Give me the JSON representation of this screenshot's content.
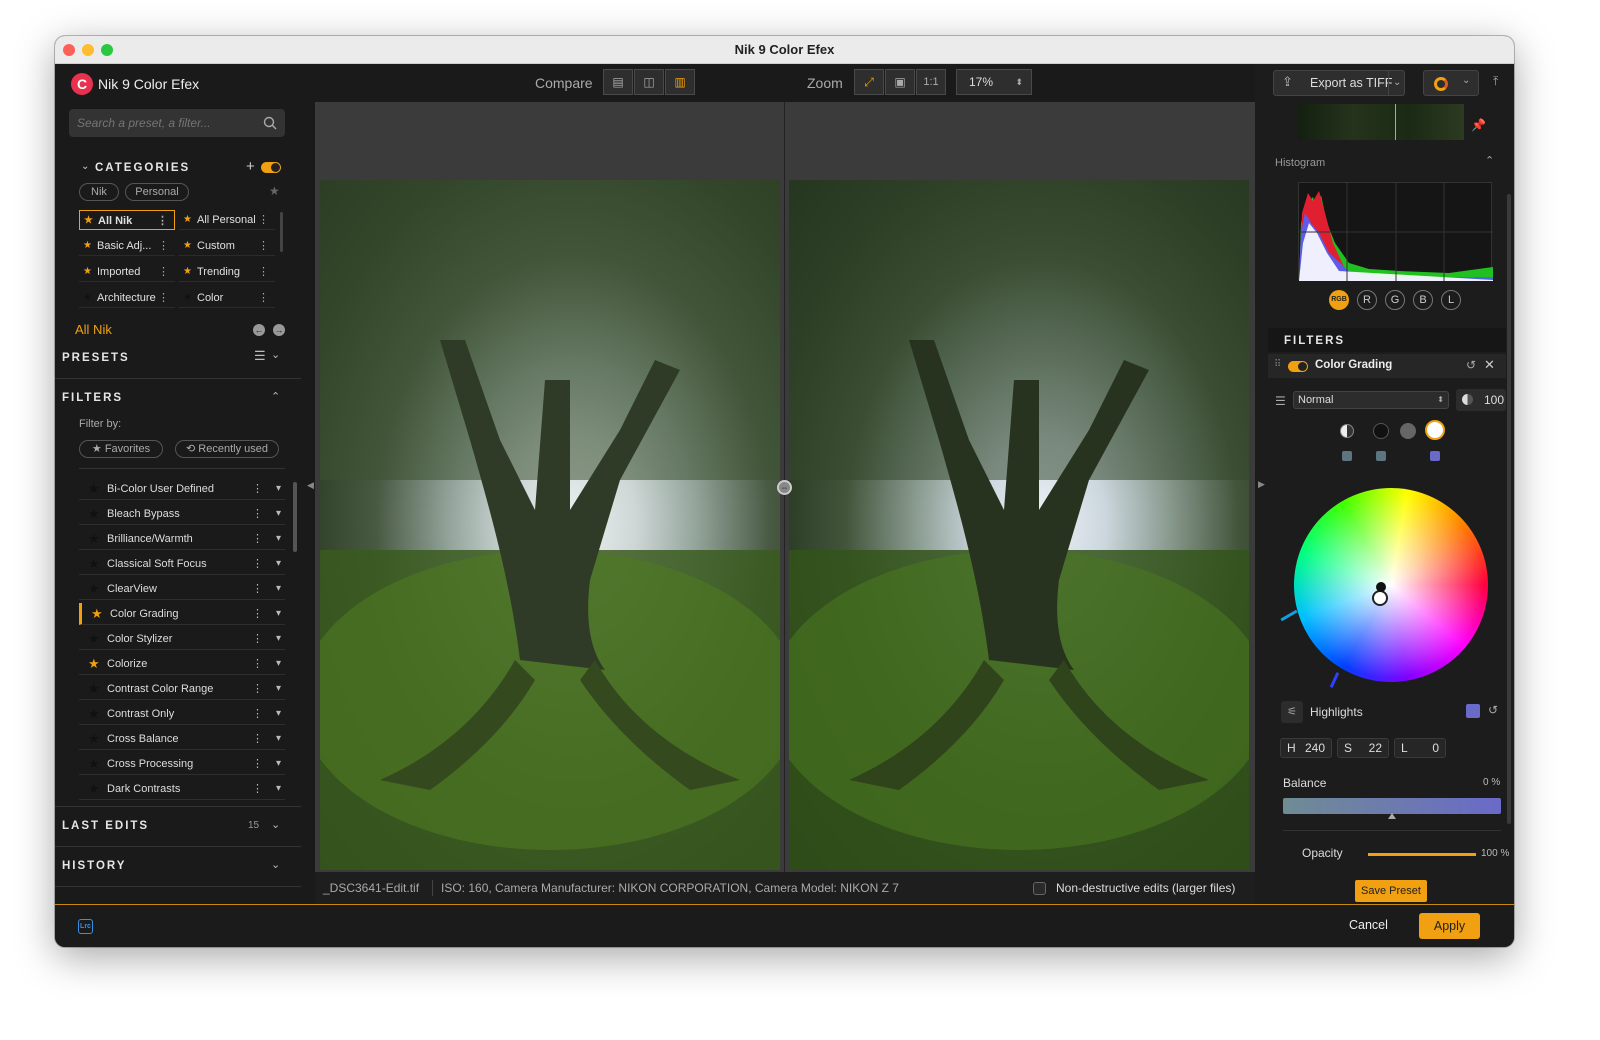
{
  "window": {
    "title": "Nik 9 Color Efex"
  },
  "app": {
    "name": "Nik 9 Color Efex"
  },
  "search": {
    "placeholder": "Search a preset, a filter..."
  },
  "categories": {
    "heading": "CATEGORIES",
    "tabs": [
      "Nik",
      "Personal"
    ],
    "items": [
      {
        "label": "All Nik",
        "starred": true,
        "active": true
      },
      {
        "label": "All Personal",
        "starred": true
      },
      {
        "label": "Basic Adj...",
        "starred": true
      },
      {
        "label": "Custom",
        "starred": true
      },
      {
        "label": "Imported",
        "starred": true
      },
      {
        "label": "Trending",
        "starred": true
      },
      {
        "label": "Architecture",
        "starred": false
      },
      {
        "label": "Color",
        "starred": false
      }
    ],
    "current": "All Nik"
  },
  "presets": {
    "heading": "PRESETS"
  },
  "filters_panel": {
    "heading": "FILTERS",
    "filter_by": "Filter by:",
    "favorites": "★ Favorites",
    "recently_used": "⟲ Recently used",
    "items": [
      {
        "label": "Bi-Color User Defined",
        "fav": false
      },
      {
        "label": "Bleach Bypass",
        "fav": false
      },
      {
        "label": "Brilliance/Warmth",
        "fav": false
      },
      {
        "label": "Classical Soft Focus",
        "fav": false
      },
      {
        "label": "ClearView",
        "fav": false
      },
      {
        "label": "Color Grading",
        "fav": true,
        "selected": true
      },
      {
        "label": "Color Stylizer",
        "fav": false
      },
      {
        "label": "Colorize",
        "fav": true
      },
      {
        "label": "Contrast Color Range",
        "fav": false
      },
      {
        "label": "Contrast Only",
        "fav": false
      },
      {
        "label": "Cross Balance",
        "fav": false
      },
      {
        "label": "Cross Processing",
        "fav": false
      },
      {
        "label": "Dark Contrasts",
        "fav": false
      }
    ]
  },
  "last_edits": {
    "heading": "LAST EDITS",
    "count": "15"
  },
  "history": {
    "heading": "HISTORY"
  },
  "toolbar": {
    "compare_label": "Compare",
    "zoom_label": "Zoom",
    "one_to_one": "1:1",
    "zoom_value": "17%"
  },
  "status": {
    "filename": "_DSC3641-Edit.tif",
    "meta": "ISO: 160, Camera Manufacturer: NIKON CORPORATION, Camera Model: NIKON Z 7",
    "nondestructive": "Non-destructive edits (larger files)"
  },
  "export": {
    "label": "Export as TIFF"
  },
  "histogram": {
    "label": "Histogram",
    "channels": [
      "RGB",
      "R",
      "G",
      "B",
      "L"
    ],
    "active_channel": "RGB"
  },
  "filters_right": {
    "heading": "FILTERS"
  },
  "filter": {
    "name": "Color Grading",
    "blend_mode": "Normal",
    "opacity_value": "100",
    "zone": "Highlights",
    "zone_color": "#6a6ac8",
    "h_label": "H",
    "h": "240",
    "s_label": "S",
    "s": "22",
    "l_label": "L",
    "l": "0",
    "balance_label": "Balance",
    "balance_value": "0 %",
    "balance": 0.5,
    "opacity_label": "Opacity",
    "opacity_pct": "100 %",
    "opacity": 1.0
  },
  "buttons": {
    "save_preset": "Save Preset",
    "cancel": "Cancel",
    "apply": "Apply"
  },
  "colors": {
    "accent": "#f0a010"
  },
  "host_badge": "Lrc"
}
